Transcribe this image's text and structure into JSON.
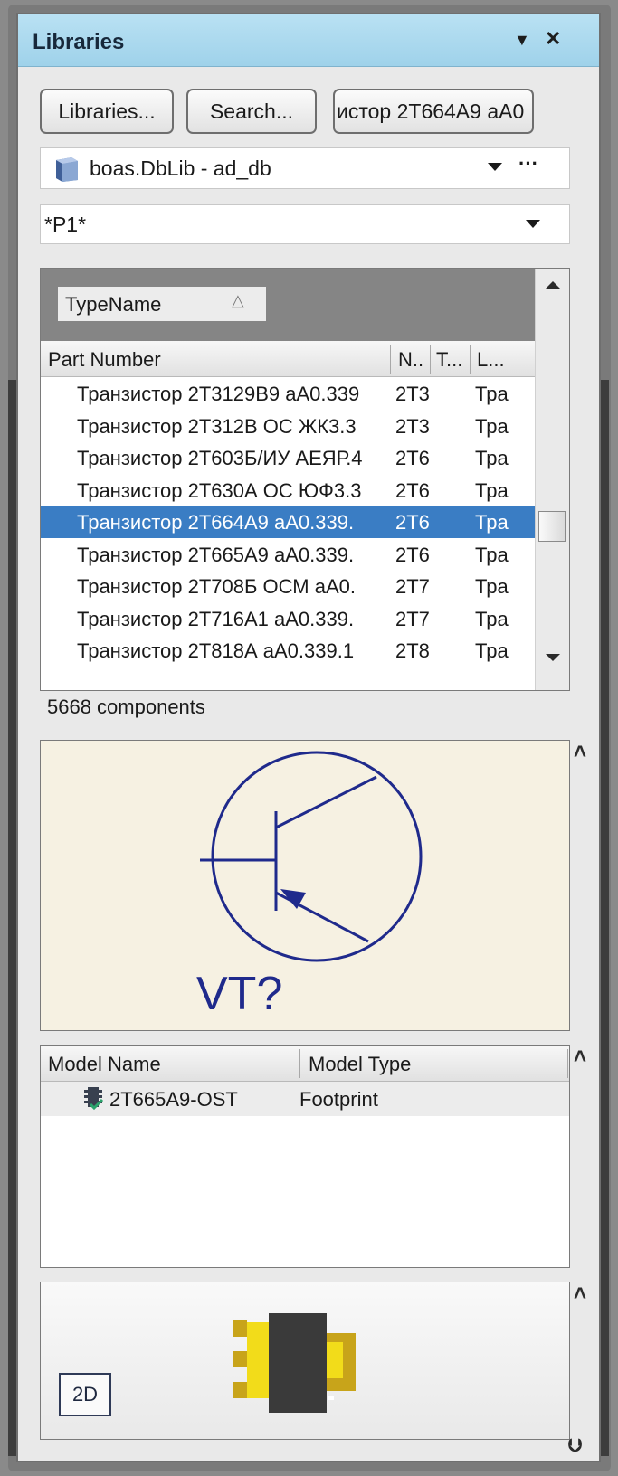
{
  "panel": {
    "title": "Libraries",
    "menu_glyph": "▼",
    "close_glyph": "✕"
  },
  "toolbar": {
    "libraries_button": "Libraries...",
    "search_button": "Search...",
    "search_field_value": "истор 2Т664А9 аА0"
  },
  "library_select": {
    "value": "boas.DbLib - ad_db",
    "more_label": "···",
    "icon": "database-icon"
  },
  "filter_select": {
    "value": "*P1*"
  },
  "component_list": {
    "group_by_label": "TypeName",
    "group_sort_glyph": "△",
    "columns": [
      "Part Number",
      "N..",
      "T...",
      "L..."
    ],
    "rows": [
      {
        "part": "Транзистор 2Т3129В9 аА0.339",
        "n": "2Т3",
        "l": "Тра",
        "selected": false
      },
      {
        "part": "Транзистор 2Т312В ОС ЖК3.3",
        "n": "2Т3",
        "l": "Тра",
        "selected": false
      },
      {
        "part": "Транзистор 2Т603Б/ИУ АЕЯР.4",
        "n": "2Т6",
        "l": "Тра",
        "selected": false
      },
      {
        "part": "Транзистор 2Т630А ОС ЮФ3.3",
        "n": "2Т6",
        "l": "Тра",
        "selected": false
      },
      {
        "part": "Транзистор 2Т664А9 аА0.339.",
        "n": "2Т6",
        "l": "Тра",
        "selected": true
      },
      {
        "part": "Транзистор 2Т665А9 аА0.339.",
        "n": "2Т6",
        "l": "Тра",
        "selected": false
      },
      {
        "part": "Транзистор 2Т708Б ОСМ аА0.",
        "n": "2Т7",
        "l": "Тра",
        "selected": false
      },
      {
        "part": "Транзистор 2Т716А1 аА0.339.",
        "n": "2Т7",
        "l": "Тра",
        "selected": false
      },
      {
        "part": "Транзистор 2Т818А аА0.339.1",
        "n": "2Т8",
        "l": "Тра",
        "selected": false
      }
    ],
    "count_label": "5668 components"
  },
  "symbol_preview": {
    "designator": "VT?",
    "stroke_color": "#1f2a8c",
    "background": "#f6f1e2"
  },
  "models": {
    "columns": [
      "Model Name",
      "Model Type"
    ],
    "rows": [
      {
        "name": "2Т665А9-OST",
        "type": "Footprint",
        "icon": "footprint-model-icon"
      }
    ]
  },
  "footprint_preview": {
    "view_toggle": "2D",
    "pad_color": "#f2dc1a",
    "body_color": "#3a3a3a"
  }
}
